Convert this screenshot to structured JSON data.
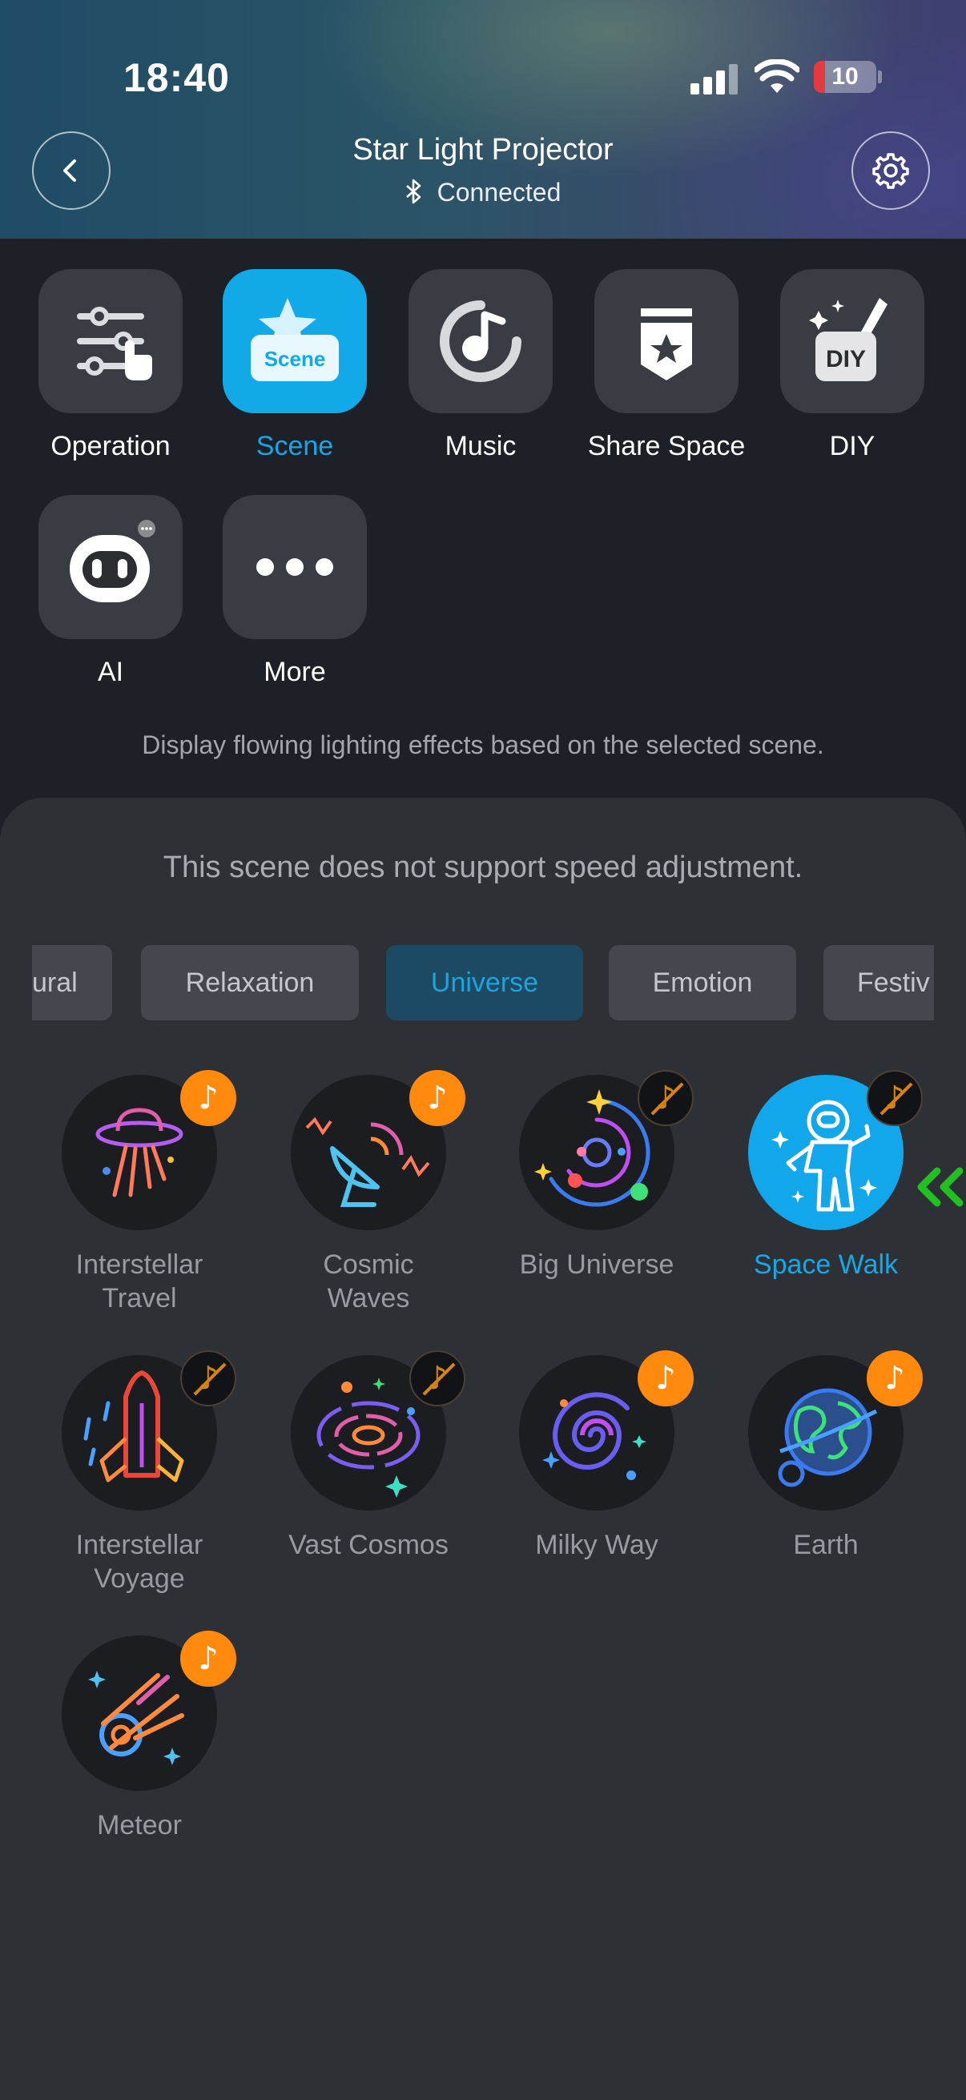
{
  "status_bar": {
    "time": "18:40",
    "battery": "10"
  },
  "header": {
    "title": "Star Light Projector",
    "connection": "Connected"
  },
  "modes": [
    {
      "label": "Operation",
      "icon": "sliders-icon",
      "active": false
    },
    {
      "label": "Scene",
      "icon": "scene-icon",
      "badge_text": "Scene",
      "active": true
    },
    {
      "label": "Music",
      "icon": "music-disc-icon",
      "active": false
    },
    {
      "label": "Share Space",
      "icon": "share-space-icon",
      "active": false
    },
    {
      "label": "DIY",
      "icon": "diy-icon",
      "badge_text": "DIY",
      "active": false
    },
    {
      "label": "AI",
      "icon": "ai-robot-icon",
      "active": false
    },
    {
      "label": "More",
      "icon": "more-icon",
      "active": false
    }
  ],
  "description": "Display flowing lighting effects based on the selected scene.",
  "panel": {
    "notice": "This scene does not support speed adjustment.",
    "tabs": [
      {
        "label": "ural",
        "active": false
      },
      {
        "label": "Relaxation",
        "active": false
      },
      {
        "label": "Universe",
        "active": true
      },
      {
        "label": "Emotion",
        "active": false
      },
      {
        "label": "Festiv",
        "active": false
      }
    ],
    "scenes": [
      {
        "name": "Interstellar Travel",
        "music": true,
        "selected": false
      },
      {
        "name": "Cosmic Waves",
        "music": true,
        "selected": false
      },
      {
        "name": "Big Universe",
        "music": false,
        "selected": false
      },
      {
        "name": "Space Walk",
        "music": false,
        "selected": true
      },
      {
        "name": "Interstellar Voyage",
        "music": false,
        "selected": false
      },
      {
        "name": "Vast Cosmos",
        "music": false,
        "selected": false
      },
      {
        "name": "Milky Way",
        "music": true,
        "selected": false
      },
      {
        "name": "Earth",
        "music": true,
        "selected": false
      },
      {
        "name": "Meteor",
        "music": true,
        "selected": false
      }
    ]
  },
  "colors": {
    "accent": "#12a9e8",
    "music_badge": "#ff8a0e",
    "arrow": "#1fc01f"
  }
}
